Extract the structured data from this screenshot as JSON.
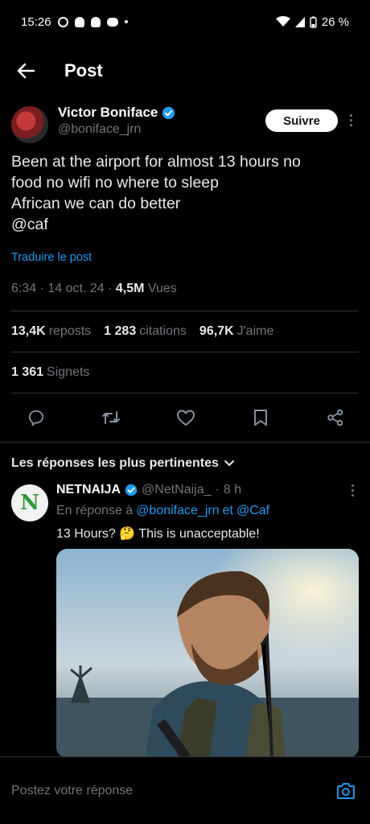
{
  "status_bar": {
    "time": "15:26",
    "battery": "26 %"
  },
  "header": {
    "title": "Post"
  },
  "tweet": {
    "author_name": "Victor Boniface",
    "handle": "@boniface_jrn",
    "follow_label": "Suivre",
    "text_lines": [
      "Been at the airport for almost 13 hours no",
      "food no wifi no where to sleep",
      "African we can do better",
      "@caf"
    ],
    "translate_label": "Traduire le post",
    "time": "6:34",
    "date": "14 oct. 24",
    "views_count": "4,5M",
    "views_label": "Vues",
    "reposts_count": "13,4K",
    "reposts_label": "reposts",
    "quotes_count": "1 283",
    "quotes_label": "citations",
    "likes_count": "96,7K",
    "likes_label": "J'aime",
    "bookmarks_count": "1 361",
    "bookmarks_label": "Signets"
  },
  "replies_section": {
    "sort_label": "Les réponses les plus pertinentes"
  },
  "reply": {
    "name": "NETNAIJA",
    "handle": "@NetNaija_",
    "age": "8 h",
    "in_reply_prefix": "En réponse à",
    "in_reply_handle1": "@boniface_jrn",
    "in_reply_and": "et",
    "in_reply_handle2": "@Caf",
    "text": "13 Hours? 🤔 This is unacceptable!",
    "avatar_letter": "N"
  },
  "composer": {
    "placeholder": "Postez votre réponse"
  },
  "colors": {
    "accent": "#1d9bf0",
    "background": "#000000",
    "muted": "#71767b"
  }
}
